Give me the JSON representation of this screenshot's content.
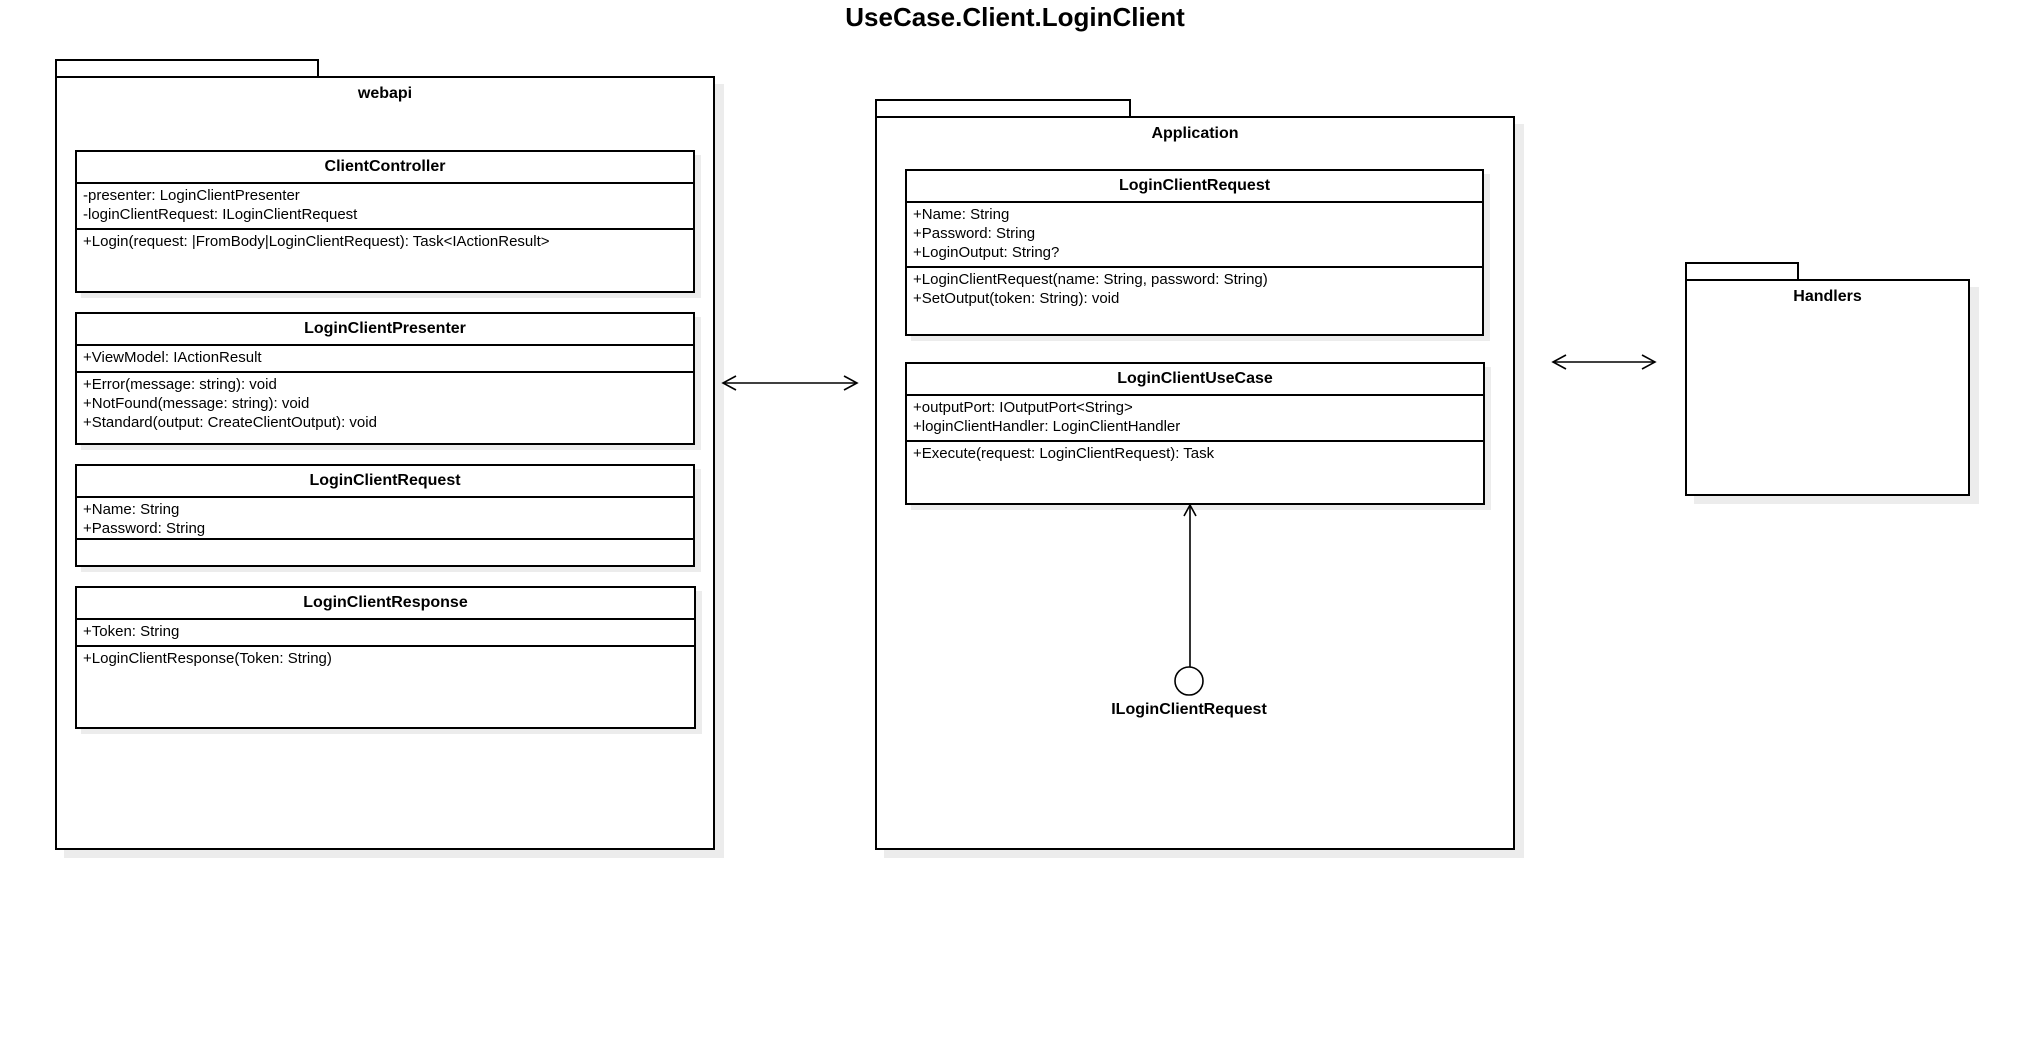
{
  "title": "UseCase.Client.LoginClient",
  "packages": {
    "webapi": {
      "name": "webapi",
      "classes": {
        "client_controller": {
          "name": "ClientController",
          "attributes": [
            "-presenter: LoginClientPresenter",
            "-loginClientRequest: ILoginClientRequest"
          ],
          "operations": [
            "+Login(request: |FromBody|LoginClientRequest): Task<IActionResult>"
          ]
        },
        "login_client_presenter": {
          "name": "LoginClientPresenter",
          "attributes": [
            "+ViewModel: IActionResult"
          ],
          "operations": [
            "+Error(message: string): void",
            "+NotFound(message: string): void",
            "+Standard(output: CreateClientOutput): void"
          ]
        },
        "login_client_request": {
          "name": "LoginClientRequest",
          "attributes": [
            "+Name: String",
            "+Password: String"
          ],
          "operations": []
        },
        "login_client_response": {
          "name": "LoginClientResponse",
          "attributes": [
            "+Token: String"
          ],
          "operations": [
            "+LoginClientResponse(Token: String)"
          ]
        }
      }
    },
    "application": {
      "name": "Application",
      "classes": {
        "login_client_request": {
          "name": "LoginClientRequest",
          "attributes": [
            "+Name: String",
            "+Password: String",
            "+LoginOutput: String?"
          ],
          "operations": [
            "+LoginClientRequest(name: String, password: String)",
            "+SetOutput(token: String): void"
          ]
        },
        "login_client_use_case": {
          "name": "LoginClientUseCase",
          "attributes": [
            "+outputPort: IOutputPort<String>",
            "+loginClientHandler: LoginClientHandler"
          ],
          "operations": [
            "+Execute(request: LoginClientRequest): Task"
          ]
        }
      },
      "interface": {
        "name": "ILoginClientRequest"
      }
    },
    "handlers": {
      "name": "Handlers"
    }
  }
}
